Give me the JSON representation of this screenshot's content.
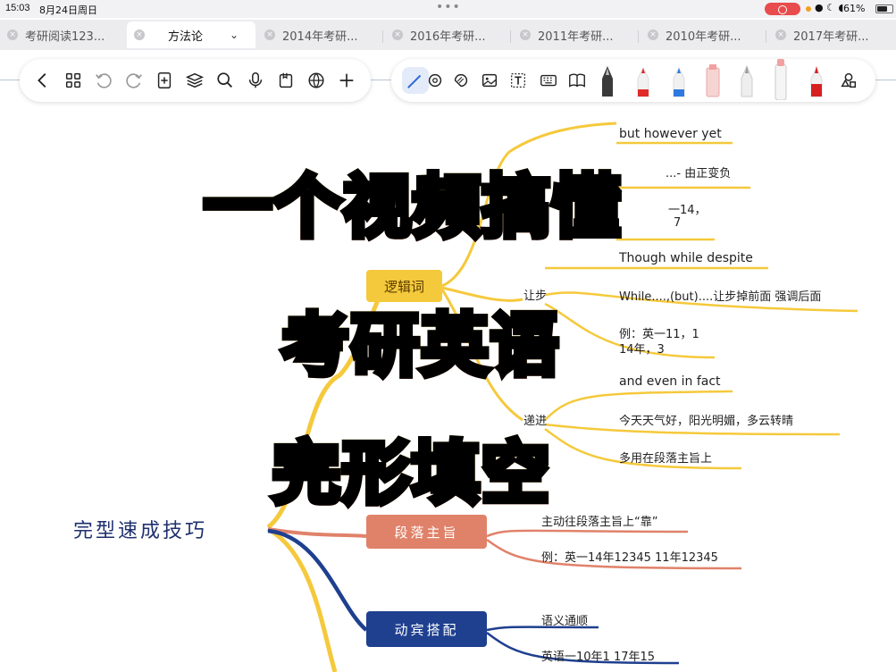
{
  "status_bar": {
    "time": "15:03",
    "date": "8月24日周日",
    "battery": "61%"
  },
  "tabs": [
    {
      "label": "考研阅读123...",
      "active": false
    },
    {
      "label": "方法论",
      "active": true
    },
    {
      "label": "2014年考研...",
      "active": false
    },
    {
      "label": "2016年考研...",
      "active": false
    },
    {
      "label": "2011年考研...",
      "active": false
    },
    {
      "label": "2010年考研...",
      "active": false
    },
    {
      "label": "2017年考研...",
      "active": false
    }
  ],
  "toolbar_left_icons": [
    "back-icon",
    "grid-icon",
    "undo-icon",
    "redo-icon",
    "add-page-icon",
    "layers-icon",
    "search-icon",
    "microphone-icon",
    "bookmark-icon",
    "globe-icon",
    "plus-icon"
  ],
  "toolbar_right_icons": [
    "pen-icon",
    "lasso-icon",
    "sticker-icon",
    "image-icon",
    "text-box-icon",
    "keyboard-icon",
    "book-icon",
    "fountain-pen-icon",
    "red-marker-icon",
    "blue-marker-icon",
    "pink-highlighter-icon",
    "pencil-icon",
    "white-marker-icon",
    "red-pen-icon",
    "shapes-icon"
  ],
  "mindmap": {
    "root": "完型速成技巧",
    "logic_node": "逻辑词",
    "logic_branch_concession": "让步",
    "logic_branch_progression": "递进",
    "logic_items": [
      "but however yet",
      "...- 由正变负",
      "一14，",
      "7",
      "Though  while  despite",
      "While....,(but)....让步掉前面 强调后面",
      "例：英一11，1",
      "14年，3",
      "and even in fact",
      "今天天气好，阳光明媚，多云转晴",
      "多用在段落主旨上"
    ],
    "paragraph_node": "段落主旨",
    "paragraph_items": [
      "主动往段落主旨上“靠”",
      "例：英一14年12345 11年12345"
    ],
    "verb_node": "动宾搭配",
    "verb_items": [
      "语义通顺",
      "英语一10年1  17年15"
    ]
  },
  "overlay_title": {
    "line1": "一个视频搞懂",
    "line2": "考研英语",
    "line3": "完形填空"
  },
  "colors": {
    "yellow_branch": "#f5c93c",
    "salmon_branch": "#e0826a",
    "navy_branch": "#1f3f8f",
    "root_text": "#1e2f6e"
  }
}
